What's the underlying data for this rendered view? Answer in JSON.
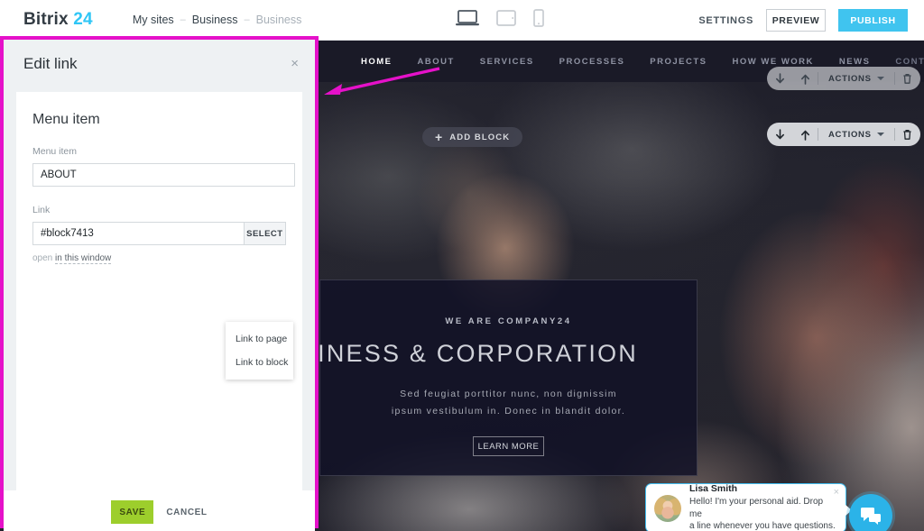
{
  "header": {
    "brand_name": "Bitrix",
    "brand_number": "24",
    "breadcrumb": [
      {
        "label": "My sites",
        "muted": false
      },
      {
        "label": "Business",
        "muted": false
      },
      {
        "label": "Business",
        "muted": true
      }
    ],
    "separator": "–",
    "devices": [
      {
        "name": "desktop",
        "active": true
      },
      {
        "name": "tablet",
        "active": false
      },
      {
        "name": "mobile",
        "active": false
      }
    ],
    "settings_label": "SETTINGS",
    "preview_label": "PREVIEW",
    "publish_label": "PUBLISH",
    "accent_blue": "#40c4ef"
  },
  "panel": {
    "title": "Edit link",
    "close_icon": "×",
    "section_title": "Menu item",
    "menu_item_label": "Menu item",
    "menu_item_value": "ABOUT",
    "menu_item_placeholder": "Menu item",
    "link_label": "Link",
    "link_value": "#block7413",
    "link_placeholder": "Link",
    "select_label": "SELECT",
    "open_prefix": "open",
    "open_target": "in this window",
    "dropdown": [
      {
        "label": "Link to page"
      },
      {
        "label": "Link to block"
      }
    ],
    "save_label": "SAVE",
    "cancel_label": "CANCEL",
    "highlight_color": "#e511c9",
    "save_color": "#9dce2c"
  },
  "site": {
    "nav": [
      {
        "label": "HOME",
        "state": "active"
      },
      {
        "label": "ABOUT",
        "state": "normal"
      },
      {
        "label": "SERVICES",
        "state": "normal"
      },
      {
        "label": "PROCESSES",
        "state": "normal"
      },
      {
        "label": "PROJECTS",
        "state": "normal"
      },
      {
        "label": "HOW WE WORK",
        "state": "normal"
      },
      {
        "label": "NEWS",
        "state": "normal"
      },
      {
        "label": "CONTACT",
        "state": "dim"
      }
    ],
    "add_block_label": "ADD BLOCK",
    "add_block_icon": "+",
    "actions_label": "ACTIONS",
    "hero": {
      "kicker": "WE ARE COMPANY24",
      "headline": "BUSINESS & CORPORATION",
      "subtitle_line1": "Sed feugiat porttitor nunc, non dignissim",
      "subtitle_line2": "ipsum vestibulum in. Donec in blandit dolor.",
      "button_label": "LEARN MORE"
    },
    "chat": {
      "name": "Lisa Smith",
      "message_line1": "Hello! I'm your personal aid. Drop me",
      "message_line2": "a line whenever you have questions.",
      "close_icon": "×",
      "accent": "#2bb3e8"
    }
  }
}
